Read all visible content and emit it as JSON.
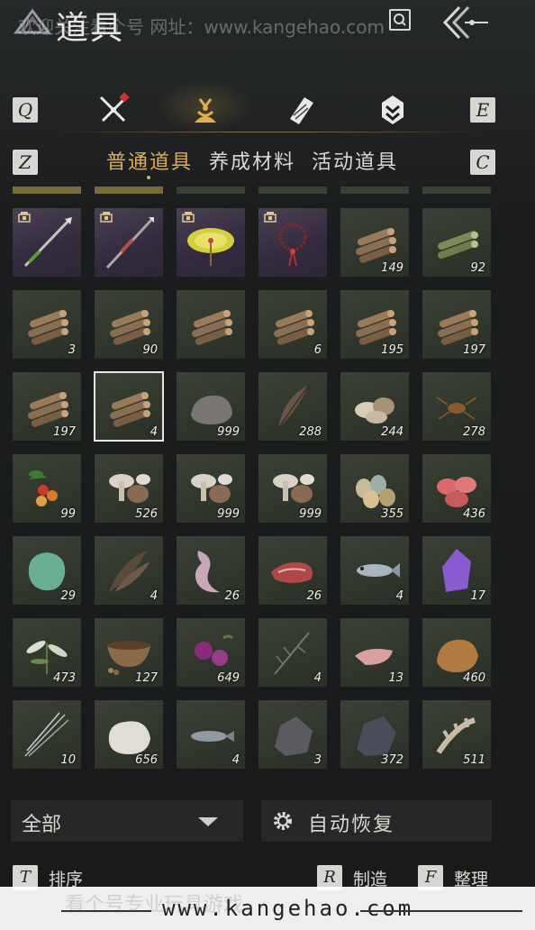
{
  "header": {
    "title": "道具",
    "watermark": "欢迎关注看个号  网址：www.kangehao.com",
    "icons": {
      "logo": "logo-icon",
      "search": "search-icon",
      "back": "back-arrow-icon"
    }
  },
  "category_tabs": {
    "left_key": "Q",
    "right_key": "E",
    "items": [
      {
        "icon": "weapons-icon",
        "active": false
      },
      {
        "icon": "items-pouch-icon",
        "active": true
      },
      {
        "icon": "scroll-icon",
        "active": false
      },
      {
        "icon": "gem-icon",
        "active": false
      }
    ]
  },
  "sub_tabs": {
    "left_key": "Z",
    "right_key": "C",
    "items": [
      {
        "label": "普通道具",
        "active": true
      },
      {
        "label": "养成材料",
        "active": false
      },
      {
        "label": "活动道具",
        "active": false
      }
    ]
  },
  "grid": {
    "rows": [
      [
        {
          "icon": "spear-icon",
          "qty": "",
          "kind": "equip",
          "locked": true
        },
        {
          "icon": "long-spear-icon",
          "qty": "",
          "kind": "equip",
          "locked": true
        },
        {
          "icon": "parasol-icon",
          "qty": "",
          "kind": "equip",
          "locked": true
        },
        {
          "icon": "prayer-beads-icon",
          "qty": "",
          "kind": "equip",
          "locked": true
        },
        {
          "icon": "logs-icon",
          "qty": "149",
          "kind": "mat"
        },
        {
          "icon": "bamboo-logs-icon",
          "qty": "92",
          "kind": "mat"
        }
      ],
      [
        {
          "icon": "logs-icon",
          "qty": "3",
          "kind": "mat"
        },
        {
          "icon": "logs-icon",
          "qty": "90",
          "kind": "mat"
        },
        {
          "icon": "logs-icon",
          "qty": "",
          "kind": "mat"
        },
        {
          "icon": "logs-icon",
          "qty": "6",
          "kind": "mat"
        },
        {
          "icon": "logs-icon",
          "qty": "195",
          "kind": "mat"
        },
        {
          "icon": "logs-icon",
          "qty": "197",
          "kind": "mat"
        }
      ],
      [
        {
          "icon": "logs-icon",
          "qty": "197",
          "kind": "mat"
        },
        {
          "icon": "logs-icon",
          "qty": "4",
          "kind": "mat",
          "selected": true
        },
        {
          "icon": "stone-icon",
          "qty": "999",
          "kind": "mat"
        },
        {
          "icon": "feather-icon",
          "qty": "288",
          "kind": "mat"
        },
        {
          "icon": "shells-icon",
          "qty": "244",
          "kind": "mat"
        },
        {
          "icon": "insect-icon",
          "qty": "278",
          "kind": "mat"
        }
      ],
      [
        {
          "icon": "berries-icon",
          "qty": "99",
          "kind": "mat"
        },
        {
          "icon": "mushrooms-icon",
          "qty": "526",
          "kind": "mat"
        },
        {
          "icon": "mushrooms-icon",
          "qty": "999",
          "kind": "mat"
        },
        {
          "icon": "mushrooms-icon",
          "qty": "999",
          "kind": "mat"
        },
        {
          "icon": "eggs-icon",
          "qty": "355",
          "kind": "mat"
        },
        {
          "icon": "raw-meat-icon",
          "qty": "436",
          "kind": "mat"
        }
      ],
      [
        {
          "icon": "jade-icon",
          "qty": "29",
          "kind": "mat"
        },
        {
          "icon": "feathers-icon",
          "qty": "4",
          "kind": "mat"
        },
        {
          "icon": "pelt-icon",
          "qty": "26",
          "kind": "mat"
        },
        {
          "icon": "steak-icon",
          "qty": "26",
          "kind": "mat"
        },
        {
          "icon": "fish-icon",
          "qty": "4",
          "kind": "mat"
        },
        {
          "icon": "amethyst-icon",
          "qty": "17",
          "kind": "mat"
        }
      ],
      [
        {
          "icon": "herb-icon",
          "qty": "473",
          "kind": "mat"
        },
        {
          "icon": "mortar-bowl-icon",
          "qty": "127",
          "kind": "mat"
        },
        {
          "icon": "flower-icon",
          "qty": "649",
          "kind": "mat"
        },
        {
          "icon": "grass-icon",
          "qty": "4",
          "kind": "mat"
        },
        {
          "icon": "meat-slice-icon",
          "qty": "13",
          "kind": "mat"
        },
        {
          "icon": "fur-icon",
          "qty": "460",
          "kind": "mat"
        }
      ],
      [
        {
          "icon": "quills-icon",
          "qty": "10",
          "kind": "mat"
        },
        {
          "icon": "wool-icon",
          "qty": "656",
          "kind": "mat"
        },
        {
          "icon": "small-fish-icon",
          "qty": "4",
          "kind": "mat"
        },
        {
          "icon": "ore-icon",
          "qty": "3",
          "kind": "mat"
        },
        {
          "icon": "dark-ore-icon",
          "qty": "372",
          "kind": "mat"
        },
        {
          "icon": "bone-icon",
          "qty": "511",
          "kind": "mat"
        }
      ]
    ]
  },
  "filter": {
    "label": "全部",
    "icon": "chevron-down-icon"
  },
  "auto_restore": {
    "label": "自动恢复",
    "icon": "gear-icon"
  },
  "hotkeys": [
    {
      "key": "T",
      "label": "排序"
    },
    {
      "key": "R",
      "label": "制造"
    },
    {
      "key": "F",
      "label": "整理"
    }
  ],
  "footer": {
    "url": "www.kangehao.com",
    "faint": "看个号专业玩具游戏"
  },
  "colors": {
    "accent": "#e2ad52",
    "material_slot": "#333a2f",
    "equip_slot": "#3d3448",
    "background": "#1c1c1d"
  }
}
